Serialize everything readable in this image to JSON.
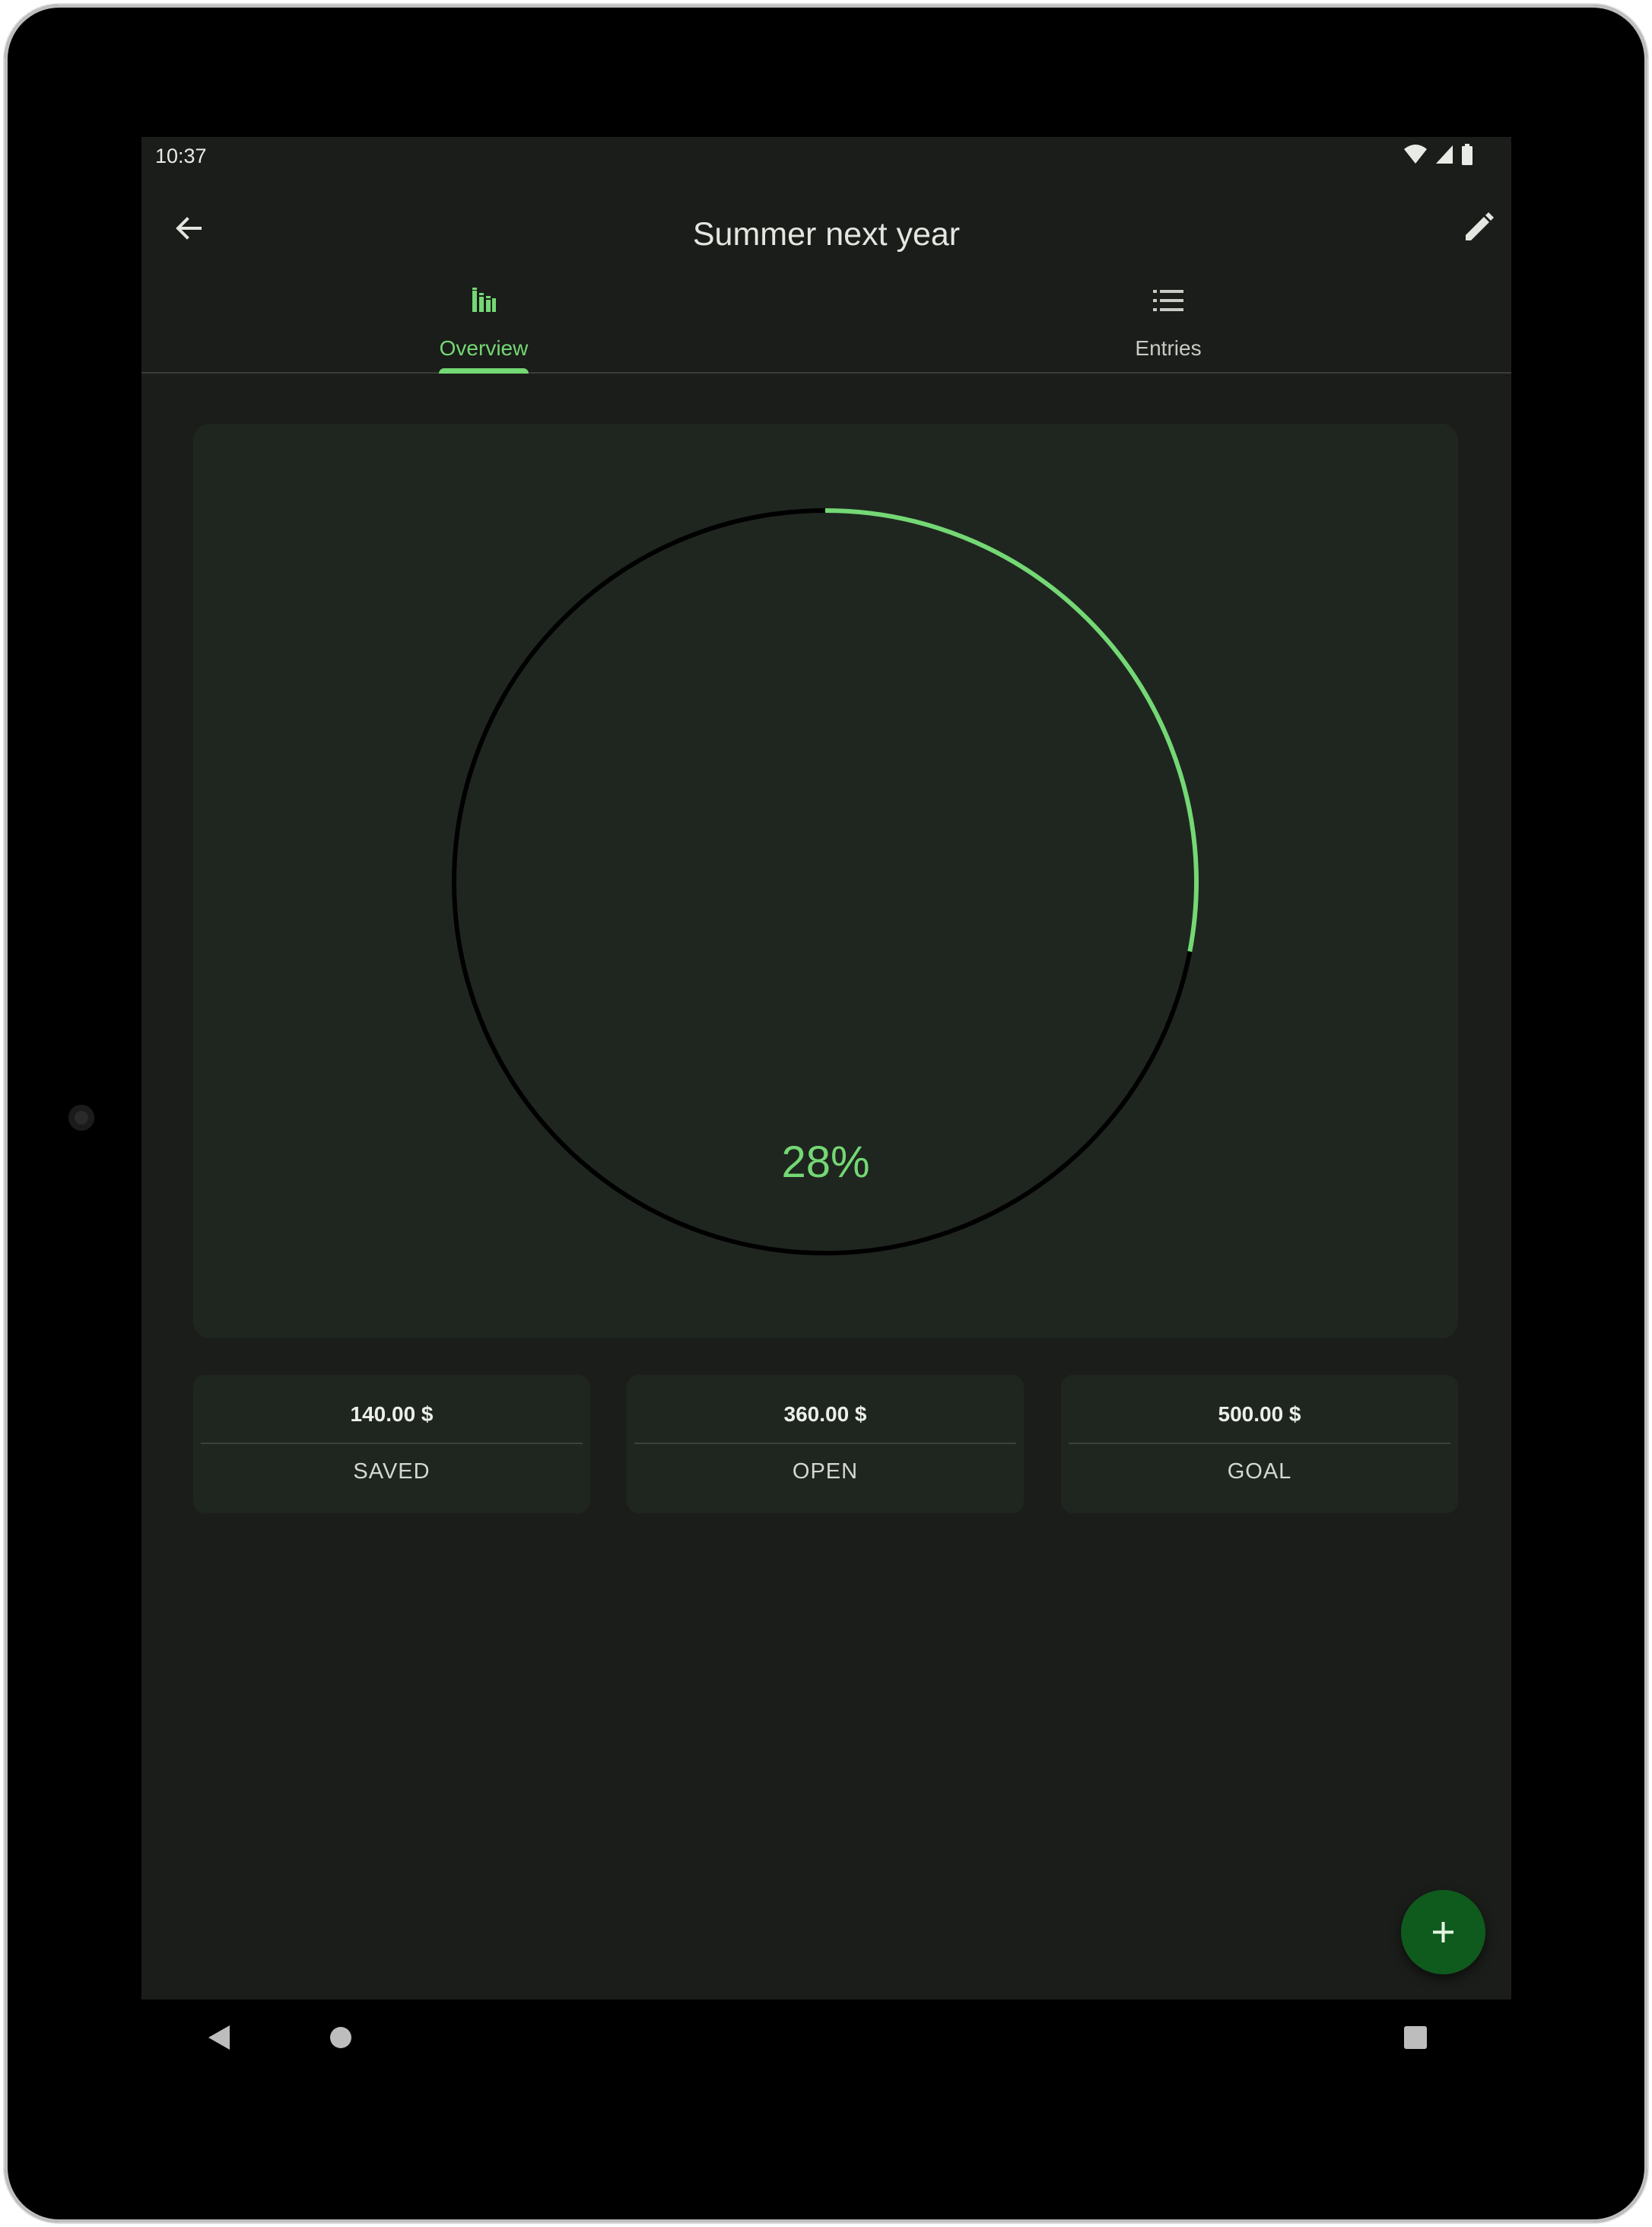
{
  "status_bar": {
    "time": "10:37",
    "icons": [
      "wifi-icon",
      "cell-signal-icon",
      "battery-icon"
    ]
  },
  "app_bar": {
    "title": "Summer next year",
    "back_icon": "arrow-back-icon",
    "edit_icon": "pencil-icon"
  },
  "tabs": [
    {
      "label": "Overview",
      "icon": "bar-chart-icon",
      "selected": true
    },
    {
      "label": "Entries",
      "icon": "list-icon",
      "selected": false
    }
  ],
  "progress": {
    "percent_label": "28%",
    "fraction": 0.28
  },
  "stats": [
    {
      "value": "140.00 $",
      "label": "SAVED"
    },
    {
      "value": "360.00 $",
      "label": "OPEN"
    },
    {
      "value": "500.00 $",
      "label": "GOAL"
    }
  ],
  "fab": {
    "icon": "plus-icon"
  },
  "nav_bar": {
    "icons": [
      "nav-back-icon",
      "nav-home-icon",
      "nav-recents-icon"
    ]
  },
  "colors": {
    "accent": "#74d874",
    "background": "#1b1d1a",
    "card": "#1f2620",
    "fab": "#0f5a1d",
    "ring_track": "#000000"
  }
}
